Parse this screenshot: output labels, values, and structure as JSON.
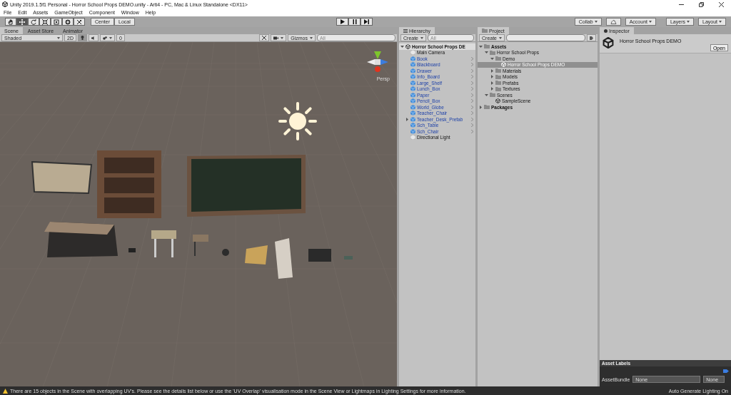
{
  "window": {
    "title": "Unity 2019.1.5f1 Personal - Horror School Props DEMO.unity - Arti4 - PC, Mac & Linux Standalone <DX11>"
  },
  "menu": [
    "File",
    "Edit",
    "Assets",
    "GameObject",
    "Component",
    "Window",
    "Help"
  ],
  "toolbar": {
    "tools": [
      {
        "kind": "hand",
        "selected": false
      },
      {
        "kind": "move",
        "selected": true
      },
      {
        "kind": "rotate",
        "selected": false
      },
      {
        "kind": "scale",
        "selected": false
      },
      {
        "kind": "rect",
        "selected": false
      },
      {
        "kind": "transform",
        "selected": false
      },
      {
        "kind": "custom",
        "selected": false
      }
    ],
    "pivot": [
      "Center",
      "Local"
    ],
    "right": [
      "Collab",
      "Account",
      "Layers",
      "Layout"
    ]
  },
  "scene_tabs": [
    {
      "label": "Scene",
      "selected": true
    },
    {
      "label": "Asset Store",
      "selected": false
    },
    {
      "label": "Animator",
      "selected": false
    }
  ],
  "scene_toolbar": {
    "shading": "Shaded",
    "mode_2d": "2D",
    "lighting_on": true,
    "audio_on": false,
    "effects_count": "0",
    "gizmos": "Gizmos",
    "search_placeholder": "All"
  },
  "scene_view": {
    "projection": "Persp"
  },
  "hierarchy": {
    "title": "Hierarchy",
    "create": "Create",
    "search_placeholder": "All",
    "scene": "Horror School Props DE",
    "items": [
      {
        "label": "Main Camera",
        "kind": "object",
        "expandable": false
      },
      {
        "label": "Book",
        "kind": "prefab",
        "expandable": false
      },
      {
        "label": "Blackboard",
        "kind": "prefab",
        "expandable": false
      },
      {
        "label": "Drawer",
        "kind": "prefab",
        "expandable": false
      },
      {
        "label": "Info_Board",
        "kind": "prefab",
        "expandable": false
      },
      {
        "label": "Large_Shelf",
        "kind": "prefab",
        "expandable": false
      },
      {
        "label": "Lunch_Box",
        "kind": "prefab",
        "expandable": false
      },
      {
        "label": "Paper",
        "kind": "prefab",
        "expandable": false
      },
      {
        "label": "Pencil_Box",
        "kind": "prefab",
        "expandable": false
      },
      {
        "label": "World_Globe",
        "kind": "prefab",
        "expandable": false
      },
      {
        "label": "Teacher_Chair",
        "kind": "prefab",
        "expandable": false
      },
      {
        "label": "Teacher_Desk_Prefab",
        "kind": "prefab",
        "expandable": true
      },
      {
        "label": "Sch_Table",
        "kind": "prefab",
        "expandable": false
      },
      {
        "label": "Sch_Chair",
        "kind": "prefab",
        "expandable": false
      },
      {
        "label": "Directional Light",
        "kind": "object",
        "expandable": false
      }
    ]
  },
  "project": {
    "title": "Project",
    "create": "Create",
    "tree": [
      {
        "label": "Assets",
        "kind": "folder",
        "bold": true,
        "expanded": true,
        "selected": false,
        "children": [
          {
            "label": "Horror School Props",
            "kind": "folder",
            "bold": false,
            "expanded": true,
            "selected": false,
            "children": [
              {
                "label": "Demo",
                "kind": "folder",
                "bold": false,
                "expanded": true,
                "selected": false,
                "children": [
                  {
                    "label": "Horror School Props DEMO",
                    "kind": "scene",
                    "bold": false,
                    "expanded": false,
                    "selected": true
                  }
                ]
              },
              {
                "label": "Materials",
                "kind": "folder",
                "bold": false,
                "expanded": false,
                "selected": false
              },
              {
                "label": "Models",
                "kind": "folder",
                "bold": false,
                "expanded": false,
                "selected": false
              },
              {
                "label": "Prefabs",
                "kind": "folder",
                "bold": false,
                "expanded": false,
                "selected": false
              },
              {
                "label": "Textures",
                "kind": "folder",
                "bold": false,
                "expanded": false,
                "selected": false
              }
            ]
          },
          {
            "label": "Scenes",
            "kind": "folder",
            "bold": false,
            "expanded": true,
            "selected": false,
            "children": [
              {
                "label": "SampleScene",
                "kind": "scene",
                "bold": false,
                "expanded": false,
                "selected": false
              }
            ]
          }
        ]
      },
      {
        "label": "Packages",
        "kind": "folder",
        "bold": true,
        "expanded": false,
        "selected": false
      }
    ]
  },
  "inspector": {
    "title": "Inspector",
    "asset_name": "Horror School Props DEMO",
    "open": "Open",
    "labels_header": "Asset Labels",
    "bundle_label": "AssetBundle",
    "bundle_value": "None",
    "variant_value": "None"
  },
  "status_bar": {
    "message": "There are 15 objects in the Scene with overlapping UV's. Please see the details list below or use the 'UV Overlap' visualisation mode in the Scene View or Lightmaps in Lighting Settings for more information.",
    "lighting": "Auto Generate Lighting On"
  }
}
